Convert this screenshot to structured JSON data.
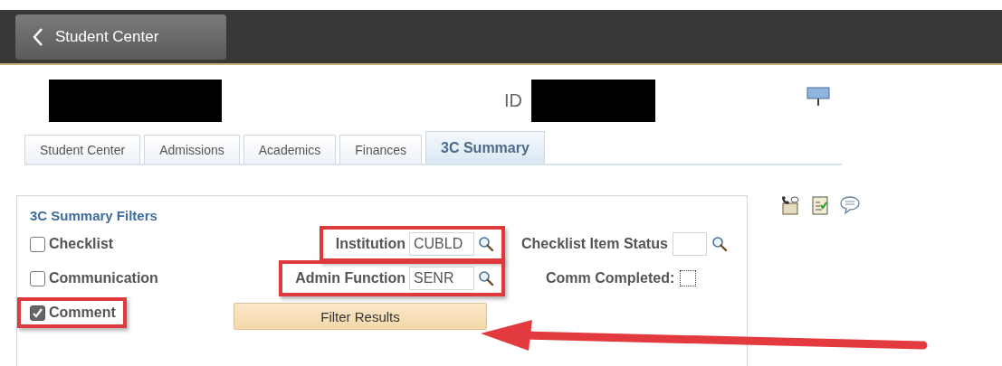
{
  "header": {
    "back_button": "Student Center"
  },
  "student": {
    "id_label": "ID"
  },
  "tabs": [
    {
      "label": "Student Center",
      "selected": false
    },
    {
      "label": "Admissions",
      "selected": false
    },
    {
      "label": "Academics",
      "selected": false
    },
    {
      "label": "Finances",
      "selected": false
    },
    {
      "label": "3C Summary",
      "selected": true
    }
  ],
  "filters": {
    "title": "3C Summary Filters",
    "checkboxes": [
      {
        "label": "Checklist",
        "checked": false,
        "highlighted": false
      },
      {
        "label": "Communication",
        "checked": false,
        "highlighted": false
      },
      {
        "label": "Comment",
        "checked": true,
        "highlighted": true
      }
    ],
    "lookup_fields": [
      {
        "label": "Institution",
        "value": "CUBLD",
        "highlighted": true
      },
      {
        "label": "Admin Function",
        "value": "SENR",
        "highlighted": true
      }
    ],
    "status_field": {
      "label": "Checklist Item Status"
    },
    "comm_completed": {
      "label": "Comm Completed:",
      "checked": false
    },
    "button": "Filter Results"
  }
}
